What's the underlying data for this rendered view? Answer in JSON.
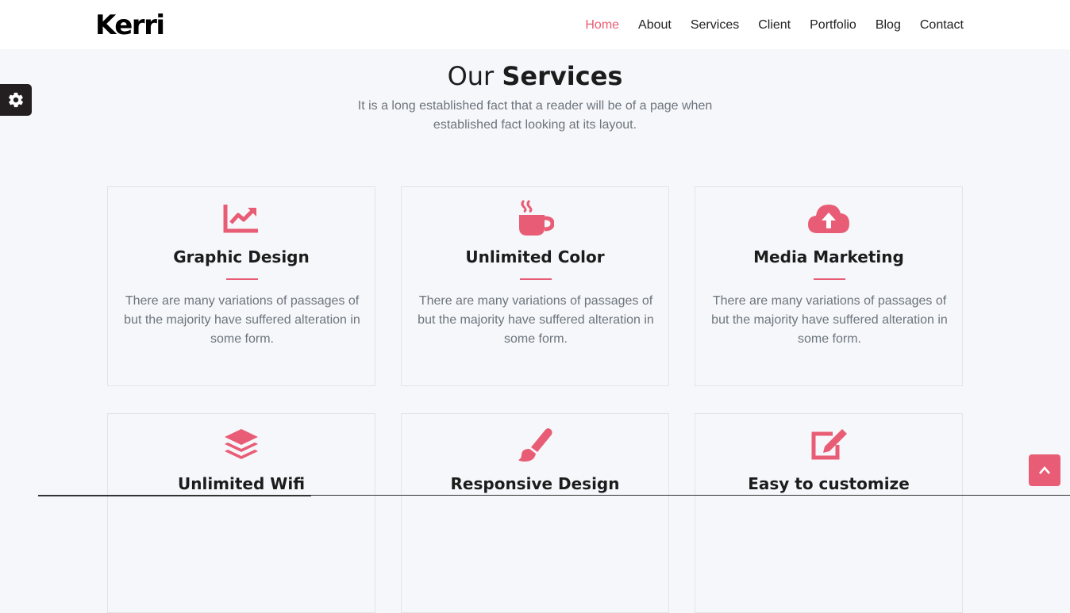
{
  "brand": {
    "name": "Kerri"
  },
  "nav": {
    "items": [
      {
        "label": "Home",
        "active": true
      },
      {
        "label": "About"
      },
      {
        "label": "Services"
      },
      {
        "label": "Client"
      },
      {
        "label": "Portfolio"
      },
      {
        "label": "Blog"
      },
      {
        "label": "Contact"
      }
    ]
  },
  "settings": {
    "icon": "gear-icon"
  },
  "section": {
    "title_light": "Our ",
    "title_bold": "Services",
    "subtitle": "It is a long established fact that a reader will be of a page when established fact looking at its layout."
  },
  "services": [
    {
      "icon": "chart-line-icon",
      "title": "Graphic Design",
      "description": "There are many variations of passages of but the majority have suffered alteration in some form."
    },
    {
      "icon": "coffee-icon",
      "title": "Unlimited Color",
      "description": "There are many variations of passages of but the majority have suffered alteration in some form."
    },
    {
      "icon": "cloud-upload-icon",
      "title": "Media Marketing",
      "description": "There are many variations of passages of but the majority have suffered alteration in some form."
    },
    {
      "icon": "layers-icon",
      "title": "Unlimited Wifi",
      "description": ""
    },
    {
      "icon": "paint-brush-icon",
      "title": "Responsive Design",
      "description": ""
    },
    {
      "icon": "edit-icon",
      "title": "Easy to customize",
      "description": ""
    }
  ],
  "scroll_top": {
    "icon": "chevron-up-icon"
  },
  "colors": {
    "accent": "#e85d75",
    "dark": "#231f20",
    "background": "#f6f7fa"
  }
}
